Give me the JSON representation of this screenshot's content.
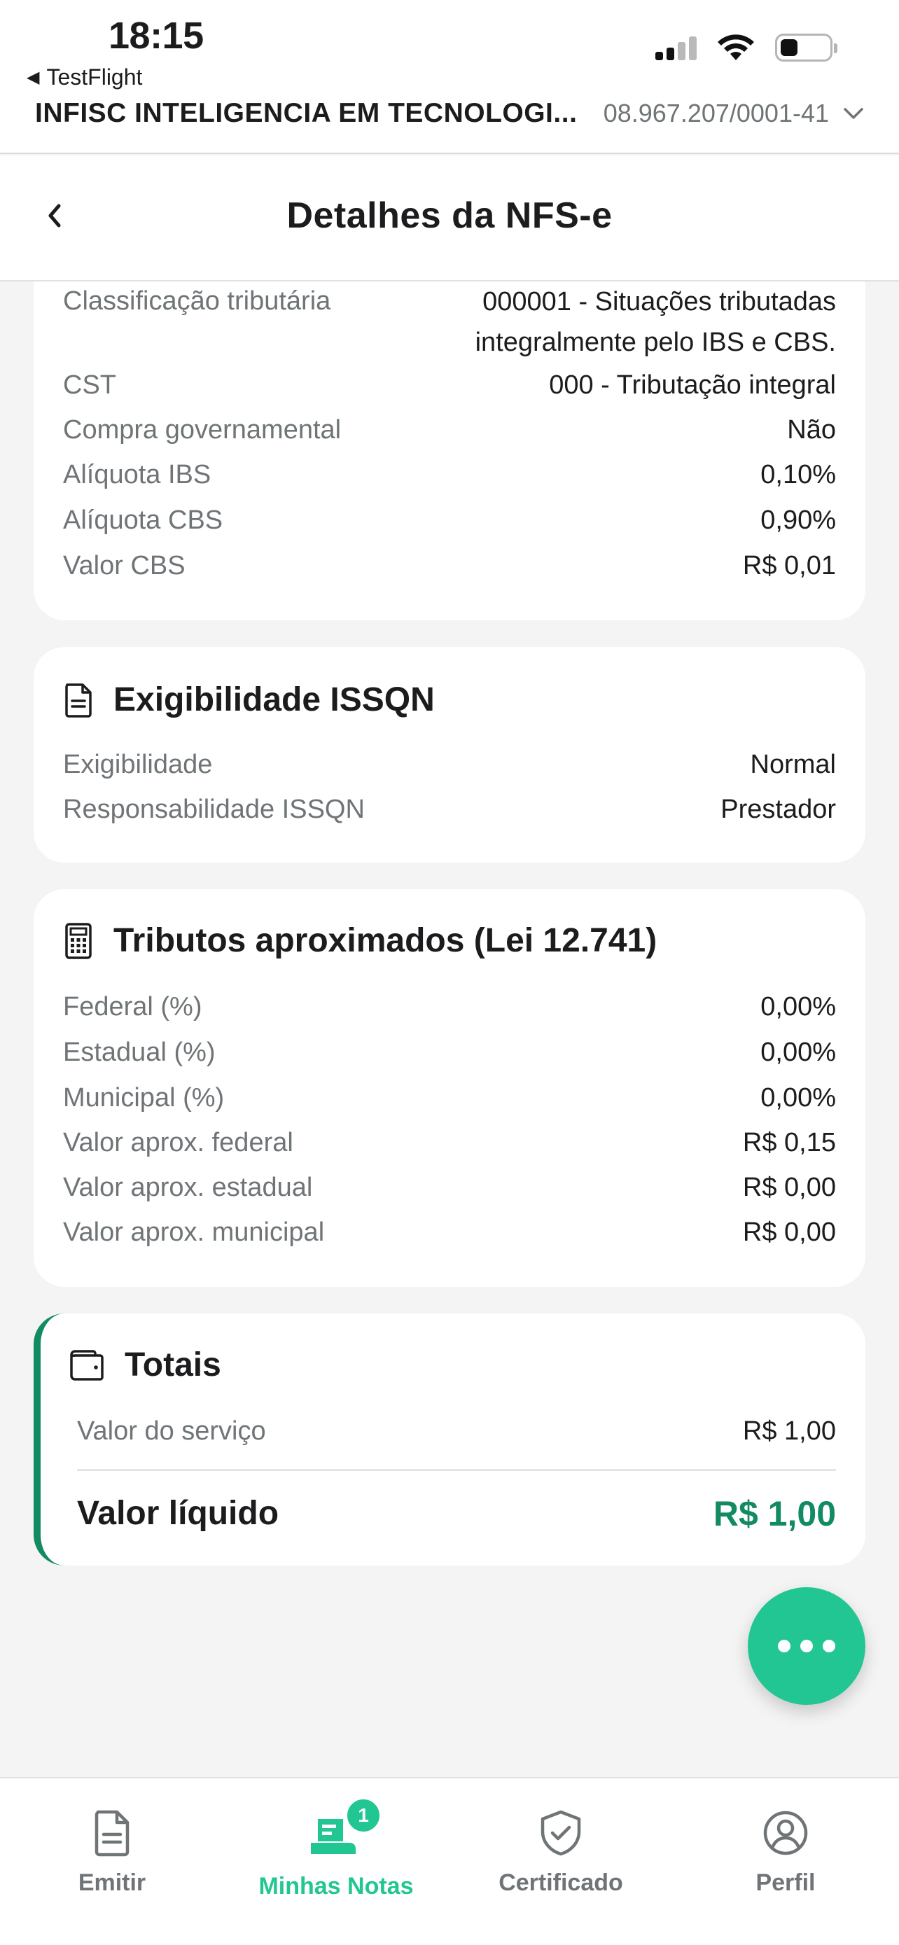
{
  "status_bar": {
    "time": "18:15",
    "back_app": "TestFlight"
  },
  "header": {
    "company_name": "INFISC INTELIGENCIA EM TECNOLOGI...",
    "cnpj": "08.967.207/0001-41"
  },
  "navbar": {
    "title": "Detalhes da NFS-e"
  },
  "ibs_cbs": {
    "rows": [
      {
        "label": "Classificação tributária",
        "value_line1": "000001 - Situações tributadas",
        "value_line2": "integralmente pelo IBS e CBS."
      },
      {
        "label": "CST",
        "value": "000 - Tributação integral"
      },
      {
        "label": "Compra governamental",
        "value": "Não"
      },
      {
        "label": "Alíquota IBS",
        "value": "0,10%"
      },
      {
        "label": "Alíquota CBS",
        "value": "0,90%"
      },
      {
        "label": "Valor CBS",
        "value": "R$ 0,01"
      }
    ]
  },
  "exigibilidade": {
    "title": "Exigibilidade ISSQN",
    "rows": [
      {
        "label": "Exigibilidade",
        "value": "Normal"
      },
      {
        "label": "Responsabilidade ISSQN",
        "value": "Prestador"
      }
    ]
  },
  "tributos": {
    "title": "Tributos aproximados (Lei 12.741)",
    "rows": [
      {
        "label": "Federal (%)",
        "value": "0,00%"
      },
      {
        "label": "Estadual (%)",
        "value": "0,00%"
      },
      {
        "label": "Municipal (%)",
        "value": "0,00%"
      },
      {
        "label": "Valor aprox. federal",
        "value": "R$ 0,15"
      },
      {
        "label": "Valor aprox. estadual",
        "value": "R$ 0,00"
      },
      {
        "label": "Valor aprox. municipal",
        "value": "R$ 0,00"
      }
    ]
  },
  "totais": {
    "title": "Totais",
    "servico_label": "Valor do serviço",
    "servico_value": "R$ 1,00",
    "liquido_label": "Valor líquido",
    "liquido_value": "R$ 1,00"
  },
  "tabbar": {
    "items": [
      {
        "label": "Emitir"
      },
      {
        "label": "Minhas Notas",
        "badge": "1"
      },
      {
        "label": "Certificado"
      },
      {
        "label": "Perfil"
      }
    ]
  },
  "colors": {
    "accent": "#22c692",
    "accent_dark": "#128a63",
    "label_gray": "#6f7477",
    "background": "#f3f4f3"
  },
  "icons": [
    "chevron-left-icon",
    "chevron-down-icon",
    "document-icon",
    "calculator-icon",
    "wallet-icon",
    "more-icon",
    "receipt-icon",
    "shield-check-icon",
    "user-circle-icon"
  ]
}
